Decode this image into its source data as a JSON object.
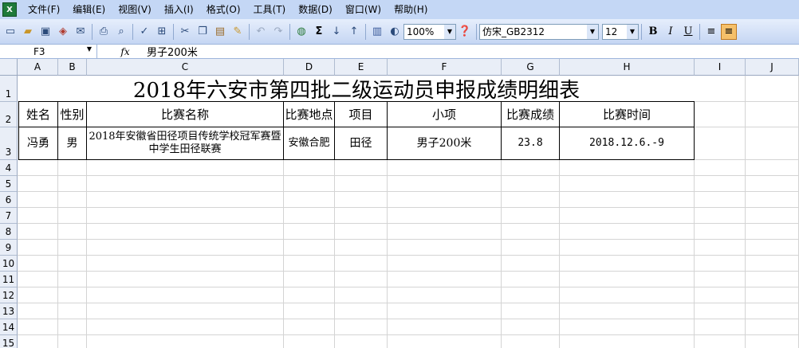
{
  "menu": {
    "app_icon": "excel-icon",
    "items": [
      "文件(F)",
      "编辑(E)",
      "视图(V)",
      "插入(I)",
      "格式(O)",
      "工具(T)",
      "数据(D)",
      "窗口(W)",
      "帮助(H)"
    ]
  },
  "toolbar": {
    "zoom": "100%",
    "font_name": "仿宋_GB2312",
    "font_size": "12",
    "bold": "B",
    "italic": "I",
    "underline": "U",
    "sigma": "Σ"
  },
  "formula_bar": {
    "cell_ref": "F3",
    "fx": "fx",
    "value": "男子200米"
  },
  "sheet": {
    "columns": [
      "A",
      "B",
      "C",
      "D",
      "E",
      "F",
      "G",
      "H",
      "I",
      "J"
    ],
    "rows": [
      "1",
      "2",
      "3",
      "4",
      "5",
      "6",
      "7",
      "8",
      "9",
      "10",
      "11",
      "12",
      "13",
      "14",
      "15"
    ],
    "title": "2018年六安市第四批二级运动员申报成绩明细表",
    "headers": [
      "姓名",
      "性别",
      "比赛名称",
      "比赛地点",
      "项目",
      "小项",
      "比赛成绩",
      "比赛时间"
    ],
    "record": [
      "冯勇",
      "男",
      "2018年安徽省田径项目传统学校冠军赛暨中学生田径联赛",
      "安徽合肥",
      "田径",
      "男子200米",
      "23.8",
      "2018.12.6.-9"
    ]
  }
}
